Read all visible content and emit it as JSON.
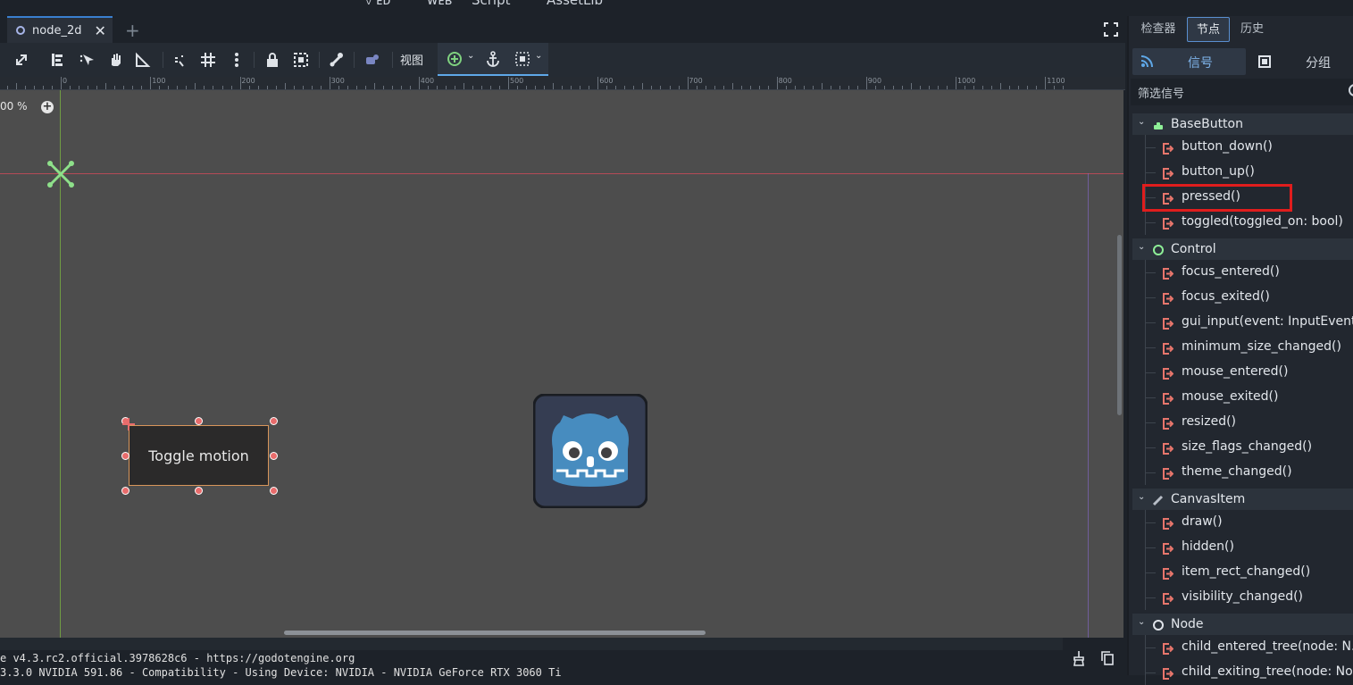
{
  "top_strip": {
    "partial_text_1": "ᵥ ᴇᴅ",
    "partial_text_2": "ᴡᴇʙ",
    "partial_text_3": "Script",
    "partial_text_4": "AssetLib"
  },
  "scene_tabs": [
    {
      "label": "node_2d",
      "close": "✕"
    }
  ],
  "add_tab": "+",
  "toolbar": {
    "view_menu": "视图",
    "icons": [
      "select-icon",
      "list-select-icon",
      "move-icon",
      "pan-hand-icon",
      "ruler-icon",
      "smart-snap-icon",
      "grid-icon",
      "more-icon",
      "lock-icon",
      "group-icon",
      "bone-icon",
      "camera-icon",
      "snap-icon",
      "anchor-icon",
      "layout-icon"
    ]
  },
  "ruler": {
    "ticks": [
      "0",
      "100",
      "200",
      "300",
      "400",
      "500",
      "600",
      "700",
      "800",
      "900",
      "1000",
      "1100"
    ]
  },
  "viewport": {
    "zoom": "00 %",
    "button_text": "Toggle motion"
  },
  "console": {
    "line1": "e v4.3.rc2.official.3978628c6 - https://godotengine.org",
    "line2": "3.3.0 NVIDIA 591.86 - Compatibility - Using Device: NVIDIA - NVIDIA GeForce RTX 3060 Ti"
  },
  "right_panel": {
    "tabs": [
      "检查器",
      "节点",
      "历史"
    ],
    "active_tab": "节点",
    "subtabs": {
      "signals": "信号",
      "groups": "分组"
    },
    "filter_placeholder": "筛选信号",
    "groups": [
      {
        "name": "BaseButton",
        "icon": "base-button-icon",
        "signals": [
          "button_down()",
          "button_up()",
          "pressed()",
          "toggled(toggled_on: bool)"
        ]
      },
      {
        "name": "Control",
        "icon": "control-icon",
        "signals": [
          "focus_entered()",
          "focus_exited()",
          "gui_input(event: InputEvent)",
          "minimum_size_changed()",
          "mouse_entered()",
          "mouse_exited()",
          "resized()",
          "size_flags_changed()",
          "theme_changed()"
        ]
      },
      {
        "name": "CanvasItem",
        "icon": "canvas-item-icon",
        "signals": [
          "draw()",
          "hidden()",
          "item_rect_changed()",
          "visibility_changed()"
        ]
      },
      {
        "name": "Node",
        "icon": "node-icon",
        "signals": [
          "child_entered_tree(node: N...",
          "child_exiting_tree(node: No..."
        ]
      }
    ],
    "highlighted_signal": "pressed()"
  },
  "colors": {
    "accent": "#5fa8e8",
    "signal_icon": "#e8766c",
    "highlight_box": "#e01d1d"
  }
}
